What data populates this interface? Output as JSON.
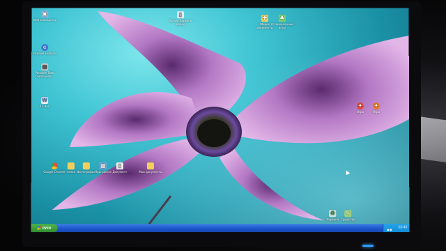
{
  "desktop": {
    "icons": [
      {
        "id": "my-computer",
        "label": "Мой компьютер",
        "icon": "computer-icon",
        "color": "#8fb7e8"
      },
      {
        "id": "internet-explorer",
        "label": "Internet Explorer",
        "icon": "ie-icon",
        "color": "#3b7de0"
      },
      {
        "id": "total-commander",
        "label": "Portable Total Commande...",
        "icon": "total-commander-icon",
        "color": "#d9d9d9"
      },
      {
        "id": "doc-file",
        "label": "12.doc",
        "icon": "word-doc-icon",
        "color": "#f2f2f2"
      },
      {
        "id": "shortcut-top",
        "label": "Ярлык Дорож к папке",
        "icon": "file-shortcut-icon",
        "color": "#e8eef5"
      },
      {
        "id": "shared-docs",
        "label": "Общие документы",
        "icon": "folder-shared-icon",
        "color": "#f0d060"
      },
      {
        "id": "installed-games",
        "label": "Установленные игры",
        "icon": "games-icon",
        "color": "#7ed26a"
      },
      {
        "id": "chrome",
        "label": "Google Chrome",
        "icon": "chrome-icon",
        "color": "#e94b3c"
      },
      {
        "id": "folder-a",
        "label": "папка",
        "icon": "folder-icon",
        "color": "#f2cf5b"
      },
      {
        "id": "folder-b",
        "label": "Фотографии",
        "icon": "folder-icon",
        "color": "#f2cf5b"
      },
      {
        "id": "program-a",
        "label": "Программа",
        "icon": "program-icon",
        "color": "#7fb0e6"
      },
      {
        "id": "file-a",
        "label": "Документ",
        "icon": "file-icon",
        "color": "#f4f4f4"
      },
      {
        "id": "folder-c",
        "label": "Мои документы",
        "icon": "folder-icon",
        "color": "#f2cf5b"
      },
      {
        "id": "app-right-1",
        "label": "Игра",
        "icon": "game-app-icon",
        "color": "#e04a3a"
      },
      {
        "id": "app-right-2",
        "label": "Игра",
        "icon": "game-app-icon",
        "color": "#e87a2a"
      },
      {
        "id": "app-bottom-1",
        "label": "Корзина",
        "icon": "recycle-bin-icon",
        "color": "#cfe6d8"
      },
      {
        "id": "app-bottom-2",
        "label": "Средство",
        "icon": "tool-icon",
        "color": "#9fd37a"
      }
    ]
  },
  "taskbar": {
    "start_label": "пуск",
    "clock": "12:45"
  },
  "colors": {
    "taskbar": "#1c55c8",
    "start": "#2f8c2d",
    "tray": "#118ad5",
    "petal": "#c98bd2",
    "background": "#3fc4d3"
  }
}
